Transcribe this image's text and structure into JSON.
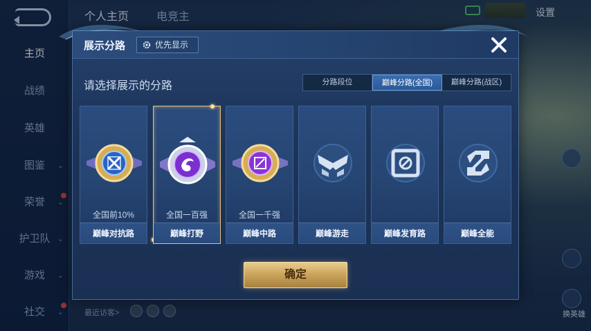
{
  "sidebar": {
    "items": [
      {
        "label": "主页",
        "active": true
      },
      {
        "label": "战绩"
      },
      {
        "label": "英雄"
      },
      {
        "label": "图鉴",
        "chevron": "⌄"
      },
      {
        "label": "荣誉",
        "chevron": "⌄"
      },
      {
        "label": "护卫队",
        "chevron": "⌄"
      },
      {
        "label": "游戏",
        "chevron": "⌄"
      },
      {
        "label": "社交",
        "chevron": "⌄"
      }
    ]
  },
  "header": {
    "tabs": [
      "个人主页",
      "电竞主"
    ],
    "settings_label": "设置"
  },
  "background": {
    "visitors_label": "最近访客>",
    "right_labels": [
      "换英雄"
    ]
  },
  "modal": {
    "title": "展示分路",
    "priority_label": "优先显示",
    "prompt": "请选择展示的分路",
    "segments": [
      {
        "label": "分路段位"
      },
      {
        "label": "巅峰分路(全国)",
        "active": true
      },
      {
        "label": "巅峰分路(战区)"
      }
    ],
    "cards": [
      {
        "rank": "全国前10%",
        "name": "巅峰对抗路",
        "emblem": "gold-sword-emblem-icon"
      },
      {
        "rank": "全国一百强",
        "name": "巅峰打野",
        "emblem": "purple-dragon-emblem-icon",
        "selected": true
      },
      {
        "rank": "全国一千强",
        "name": "巅峰中路",
        "emblem": "gold-magic-emblem-icon"
      },
      {
        "rank": "",
        "name": "巅峰游走",
        "emblem": "wings-emblem-icon"
      },
      {
        "rank": "",
        "name": "巅峰发育路",
        "emblem": "target-emblem-icon"
      },
      {
        "rank": "",
        "name": "巅峰全能",
        "emblem": "allround-emblem-icon"
      }
    ],
    "confirm_label": "确定"
  },
  "colors": {
    "accent_gold": "#e8c27a",
    "panel_blue": "#1c3358",
    "segment_active": "#3a6db1"
  }
}
